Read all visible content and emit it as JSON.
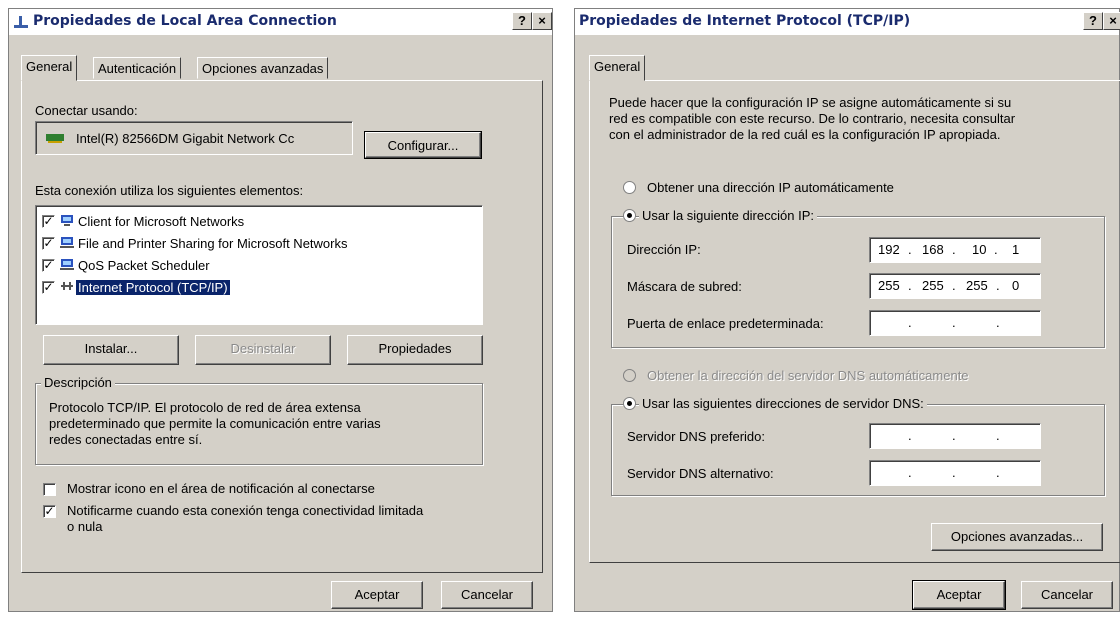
{
  "left_dialog": {
    "title": "Propiedades de Local Area Connection",
    "help_btn": "?",
    "close_btn": "×",
    "tabs": [
      "General",
      "Autenticación",
      "Opciones avanzadas"
    ],
    "connect_using_label": "Conectar usando:",
    "adapter_name": "Intel(R) 82566DM Gigabit Network Cc",
    "configure_button": "Configurar...",
    "elements_label": "Esta conexión utiliza los siguientes elementos:",
    "components": [
      {
        "label": "Client for Microsoft Networks",
        "checked": true,
        "icon": "network-client-icon"
      },
      {
        "label": "File and Printer Sharing for Microsoft Networks",
        "checked": true,
        "icon": "network-service-icon"
      },
      {
        "label": "QoS Packet Scheduler",
        "checked": true,
        "icon": "network-service-icon"
      },
      {
        "label": "Internet Protocol (TCP/IP)",
        "checked": true,
        "icon": "network-protocol-icon",
        "selected": true
      }
    ],
    "install_button": "Instalar...",
    "uninstall_button": "Desinstalar",
    "properties_button": "Propiedades",
    "description_caption": "Descripción",
    "description_text_1": "Protocolo TCP/IP. El protocolo de red de área extensa",
    "description_text_2": "predeterminado que permite la comunicación entre varias",
    "description_text_3": "redes conectadas entre sí.",
    "show_icon_label": "Mostrar icono en el área de notificación al conectarse",
    "show_icon_checked": false,
    "notify_label_1": "Notificarme cuando esta conexión tenga conectividad limitada",
    "notify_label_2": "o nula",
    "notify_checked": true,
    "ok_button": "Aceptar",
    "cancel_button": "Cancelar"
  },
  "right_dialog": {
    "title": "Propiedades de Internet Protocol (TCP/IP)",
    "help_btn": "?",
    "close_btn": "×",
    "tab": "General",
    "intro_1": "Puede hacer que la configuración IP se asigne automáticamente si su",
    "intro_2": "red es compatible con este recurso. De lo contrario, necesita consultar",
    "intro_3": "con el administrador de la red cuál es la configuración IP apropiada.",
    "auto_ip_label": "Obtener una dirección IP automáticamente",
    "manual_ip_label": "Usar la siguiente dirección IP:",
    "ip_label": "Dirección IP:",
    "ip_value": [
      "192",
      "168",
      "10",
      "1"
    ],
    "mask_label": "Máscara de subred:",
    "mask_value": [
      "255",
      "255",
      "255",
      "0"
    ],
    "gateway_label": "Puerta de enlace predeterminada:",
    "auto_dns_label": "Obtener la dirección del servidor DNS automáticamente",
    "manual_dns_label": "Usar las siguientes direcciones de servidor DNS:",
    "dns_pref_label": "Servidor DNS preferido:",
    "dns_alt_label": "Servidor DNS alternativo:",
    "advanced_button": "Opciones avanzadas...",
    "ok_button": "Aceptar",
    "cancel_button": "Cancelar"
  }
}
